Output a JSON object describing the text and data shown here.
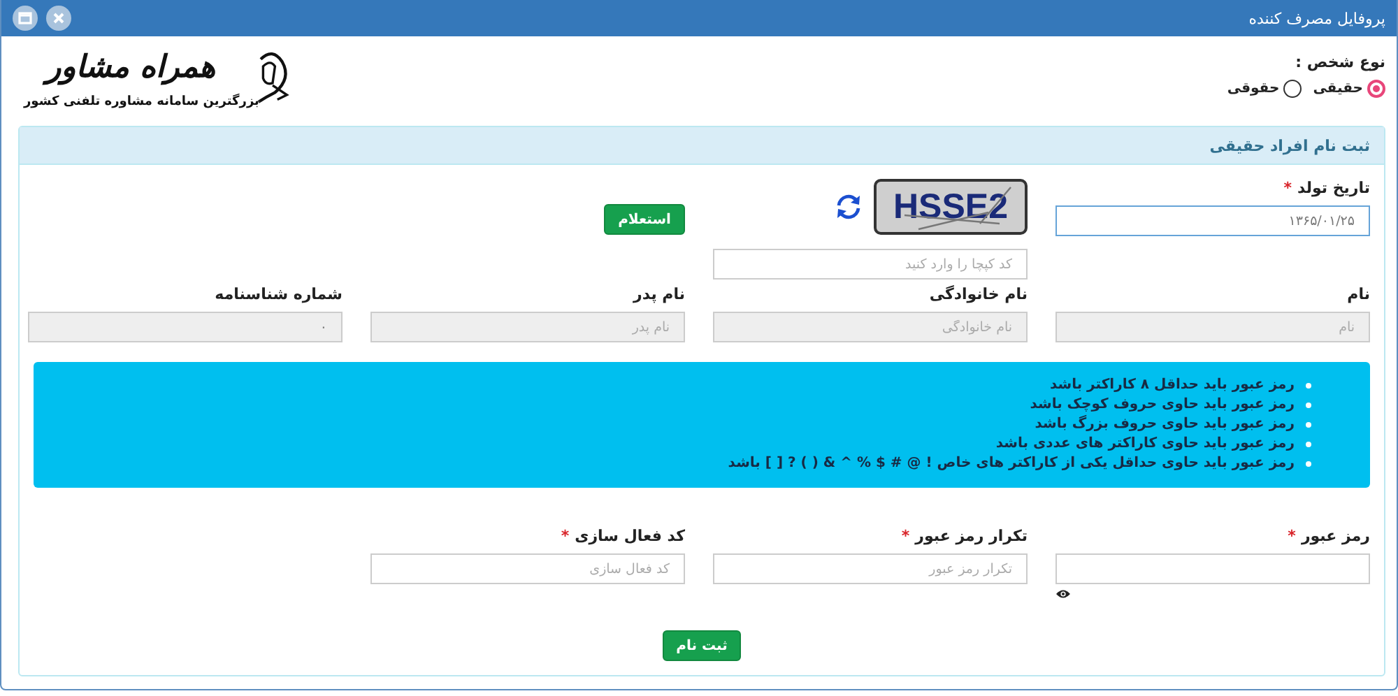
{
  "window": {
    "title": "پروفایل مصرف کننده",
    "buttons": [
      {
        "kind": "close"
      },
      {
        "kind": "maximize"
      }
    ]
  },
  "logo": {
    "name": "همراه مشاور",
    "tagline": "بزرگترین سامانه مشاوره تلفنی کشور"
  },
  "person_type": {
    "label": "نوع شخص :",
    "options": [
      {
        "label": "حقیقی",
        "selected": true
      },
      {
        "label": "حقوقی",
        "selected": false
      }
    ]
  },
  "panel": {
    "title": "ثبت نام افراد حقیقی"
  },
  "birth_date": {
    "label": "تاریخ تولد",
    "required_mark": "*",
    "value": "۱۳۶۵/۰۱/۲۵"
  },
  "captcha": {
    "text": "HSSE2",
    "placeholder": "کد کپچا را وارد کنید"
  },
  "inquiry_button": "استعلام",
  "identity_fields": [
    {
      "label": "نام",
      "placeholder": "نام",
      "disabled": true
    },
    {
      "label": "نام خانوادگی",
      "placeholder": "نام خانوادگی",
      "disabled": true
    },
    {
      "label": "نام پدر",
      "placeholder": "نام پدر",
      "disabled": true
    },
    {
      "label": "شماره شناسنامه",
      "value": "۰",
      "disabled": true
    }
  ],
  "password_rules": [
    "رمز عبور باید حداقل ۸ کاراکتر باشد",
    "رمز عبور باید حاوی حروف کوچک باشد",
    "رمز عبور باید حاوی حروف بزرگ باشد",
    "رمز عبور باید حاوی کاراکتر های عددی باشد",
    "رمز عبور باید حاوی حداقل یکی از کاراکتر های خاص ! @ # $ % ^ & ( ) ? [ ] باشد"
  ],
  "password_fields": [
    {
      "label": "رمز عبور",
      "required_mark": "*",
      "kind": "password"
    },
    {
      "label": "تکرار رمز عبور",
      "required_mark": "*",
      "placeholder": "تکرار رمز عبور",
      "kind": "text"
    },
    {
      "label": "کد فعال سازی",
      "required_mark": "*",
      "placeholder": "کد فعال سازی",
      "kind": "text"
    }
  ],
  "submit_button": "ثبت نام"
}
